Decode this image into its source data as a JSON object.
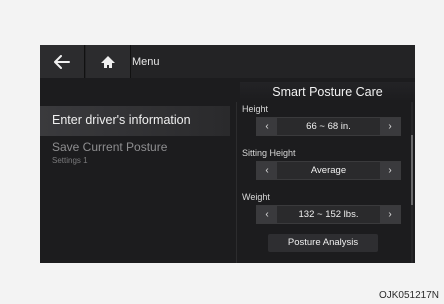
{
  "topbar": {
    "back_icon": "back-arrow-icon",
    "home_icon": "home-icon",
    "menu_label": "Menu"
  },
  "panel": {
    "title": "Smart Posture Care"
  },
  "left_menu": {
    "items": [
      {
        "label": "Enter driver's information"
      },
      {
        "label": "Save Current Posture",
        "sublabel": "Settings 1"
      }
    ]
  },
  "fields": {
    "height": {
      "label": "Height",
      "value": "66 ~ 68 in."
    },
    "sitting_height": {
      "label": "Sitting Height",
      "value": "Average"
    },
    "weight": {
      "label": "Weight",
      "value": "132 ~ 152 lbs."
    }
  },
  "arrows": {
    "left": "‹",
    "right": "›"
  },
  "buttons": {
    "posture_analysis": "Posture Analysis"
  },
  "caption": "OJK051217N"
}
